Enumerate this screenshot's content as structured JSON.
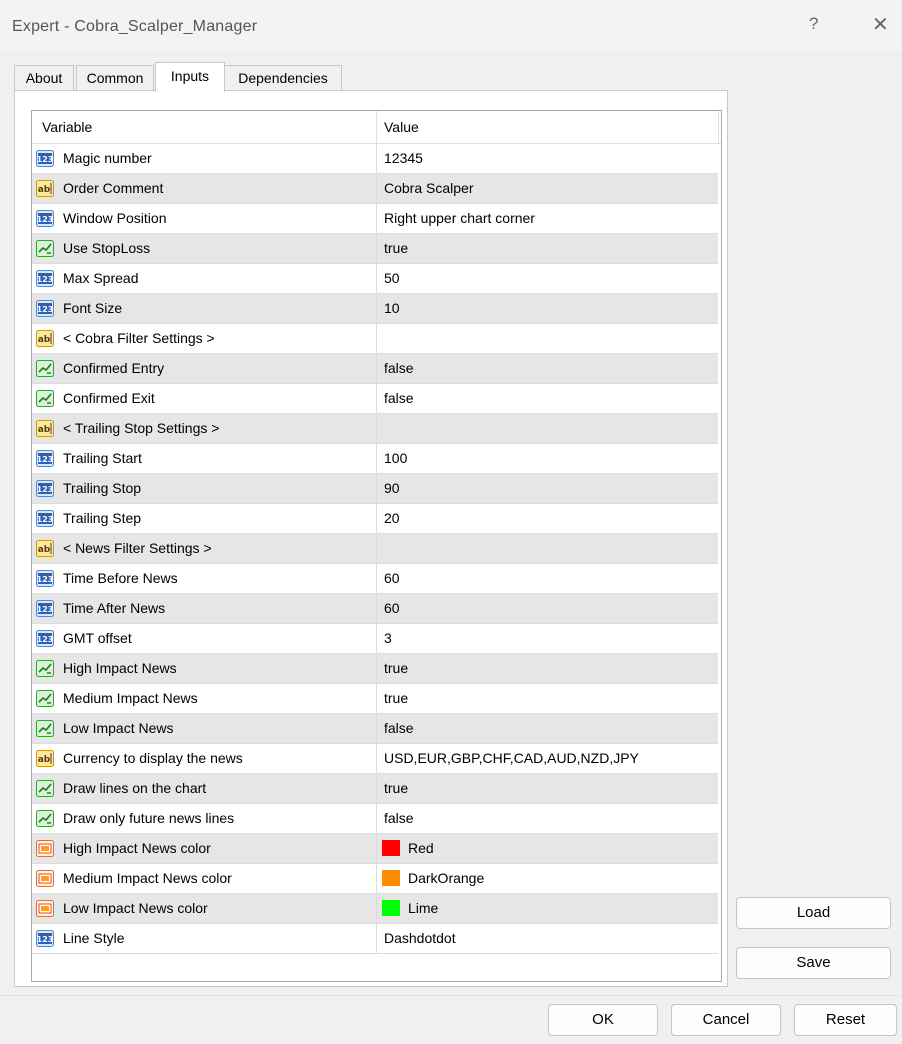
{
  "window": {
    "title": "Expert - Cobra_Scalper_Manager",
    "help_label": "?",
    "close_label": "✕"
  },
  "tabs": [
    {
      "label": "About"
    },
    {
      "label": "Common"
    },
    {
      "label": "Inputs"
    },
    {
      "label": "Dependencies"
    }
  ],
  "active_tab": "Inputs",
  "grid": {
    "columns": [
      "Variable",
      "Value"
    ],
    "rows": [
      {
        "icon": "int-icon",
        "name": "Magic number",
        "value": "12345"
      },
      {
        "icon": "string-icon",
        "name": "Order Comment",
        "value": "Cobra Scalper"
      },
      {
        "icon": "int-icon",
        "name": "Window Position",
        "value": "Right upper chart corner"
      },
      {
        "icon": "bool-icon",
        "name": "Use StopLoss",
        "value": "true"
      },
      {
        "icon": "int-icon",
        "name": "Max Spread",
        "value": "50"
      },
      {
        "icon": "int-icon",
        "name": "Font Size",
        "value": "10"
      },
      {
        "icon": "string-icon",
        "name": "< Cobra Filter Settings >",
        "value": ""
      },
      {
        "icon": "bool-icon",
        "name": "Confirmed Entry",
        "value": "false"
      },
      {
        "icon": "bool-icon",
        "name": "Confirmed Exit",
        "value": "false"
      },
      {
        "icon": "string-icon",
        "name": "< Trailing Stop Settings >",
        "value": ""
      },
      {
        "icon": "int-icon",
        "name": "Trailing Start",
        "value": "100"
      },
      {
        "icon": "int-icon",
        "name": "Trailing Stop",
        "value": "90"
      },
      {
        "icon": "int-icon",
        "name": "Trailing Step",
        "value": "20"
      },
      {
        "icon": "string-icon",
        "name": "< News Filter Settings >",
        "value": ""
      },
      {
        "icon": "int-icon",
        "name": "Time Before News",
        "value": "60"
      },
      {
        "icon": "int-icon",
        "name": "Time After News",
        "value": "60"
      },
      {
        "icon": "int-icon",
        "name": "GMT offset",
        "value": "3"
      },
      {
        "icon": "bool-icon",
        "name": "High Impact News",
        "value": "true"
      },
      {
        "icon": "bool-icon",
        "name": "Medium Impact News",
        "value": "true"
      },
      {
        "icon": "bool-icon",
        "name": "Low Impact News",
        "value": "false"
      },
      {
        "icon": "string-icon",
        "name": "Currency to display the news",
        "value": "USD,EUR,GBP,CHF,CAD,AUD,NZD,JPY"
      },
      {
        "icon": "bool-icon",
        "name": "Draw lines on the chart",
        "value": "true"
      },
      {
        "icon": "bool-icon",
        "name": "Draw only future news lines",
        "value": "false"
      },
      {
        "icon": "color-icon",
        "name": "High Impact News color",
        "value": "Red",
        "swatch": "#ff0000"
      },
      {
        "icon": "color-icon",
        "name": "Medium Impact News color",
        "value": "DarkOrange",
        "swatch": "#ff8c00"
      },
      {
        "icon": "color-icon",
        "name": "Low Impact News color",
        "value": "Lime",
        "swatch": "#00ff00"
      },
      {
        "icon": "int-icon",
        "name": "Line Style",
        "value": "Dashdotdot"
      }
    ]
  },
  "side_buttons": {
    "load": "Load",
    "save": "Save"
  },
  "bottom_buttons": {
    "ok": "OK",
    "cancel": "Cancel",
    "reset": "Reset"
  },
  "colors": {
    "row_alt": "#e6e6e6",
    "border": "#a9a9a9"
  }
}
